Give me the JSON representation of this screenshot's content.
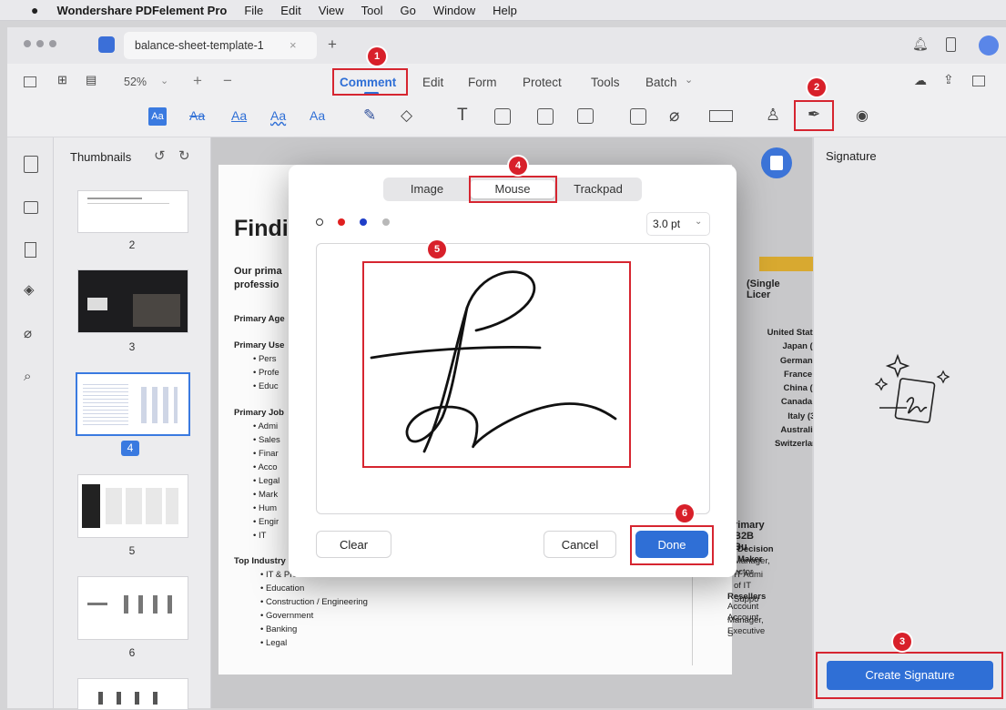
{
  "menubar": {
    "app": "Wondershare PDFelement Pro",
    "items": [
      "File",
      "Edit",
      "View",
      "Tool",
      "Go",
      "Window",
      "Help"
    ]
  },
  "tabbar": {
    "doc_tab": "balance-sheet-template-1",
    "close": "×",
    "new_tab": "+"
  },
  "toolbar": {
    "zoom": "52%",
    "tabs": [
      "Comment",
      "Edit",
      "Form",
      "Protect",
      "Tools",
      "Batch"
    ],
    "active_tab": "Comment",
    "batch_chevron": "⌄",
    "text_tools": [
      "Aa",
      "Aa",
      "Aa",
      "Aa",
      "Aa"
    ],
    "text_tool": "T"
  },
  "thumbnails": {
    "title": "Thumbnails",
    "pages": [
      "2",
      "3",
      "4",
      "5",
      "6"
    ],
    "selected": "4"
  },
  "document": {
    "heading": "Findi",
    "intro": [
      "Our prima",
      "professio"
    ],
    "primary_age": "Primary Age",
    "primary_use": "Primary Use",
    "use_items": [
      "Pers",
      "Profe",
      "Educ"
    ],
    "primary_job": "Primary Job",
    "job_items": [
      "Admi",
      "Sales",
      "Finar",
      "Acco",
      "Legal",
      "Mark",
      "Hum",
      "Engir",
      "IT"
    ],
    "top_industry": "Top Industry",
    "industry_items": [
      "IT & Professional Services",
      "Education",
      "Construction / Engineering",
      "Government",
      "Banking",
      "Legal"
    ],
    "license_title": "(Single Licer",
    "countries": [
      "United State",
      "Japan (1",
      "Germany",
      "France (",
      "China (8",
      "Canada (",
      "Italy (3.",
      "Australia",
      "Switzerlan"
    ],
    "b2b_title": "rimary B2B Bu",
    "b2b_lines": [
      "Decision Maker",
      "Manager, IT Admi",
      "ector of IT Suppo"
    ],
    "resellers": "Resellers",
    "reseller_lines": [
      "Account Manager, S",
      "Account Executive"
    ]
  },
  "dialog": {
    "tabs": [
      "Image",
      "Mouse",
      "Trackpad"
    ],
    "active_tab": "Mouse",
    "colors": [
      "#333333",
      "#e02020",
      "#1f3ec8",
      "#b8b8b8"
    ],
    "stroke": "3.0 pt",
    "clear": "Clear",
    "cancel": "Cancel",
    "done": "Done"
  },
  "signature_panel": {
    "title": "Signature",
    "create_button": "Create Signature"
  },
  "callouts": [
    "1",
    "2",
    "3",
    "4",
    "5",
    "6"
  ],
  "accent": "#2f6fd6",
  "callout_color": "#d8202a"
}
